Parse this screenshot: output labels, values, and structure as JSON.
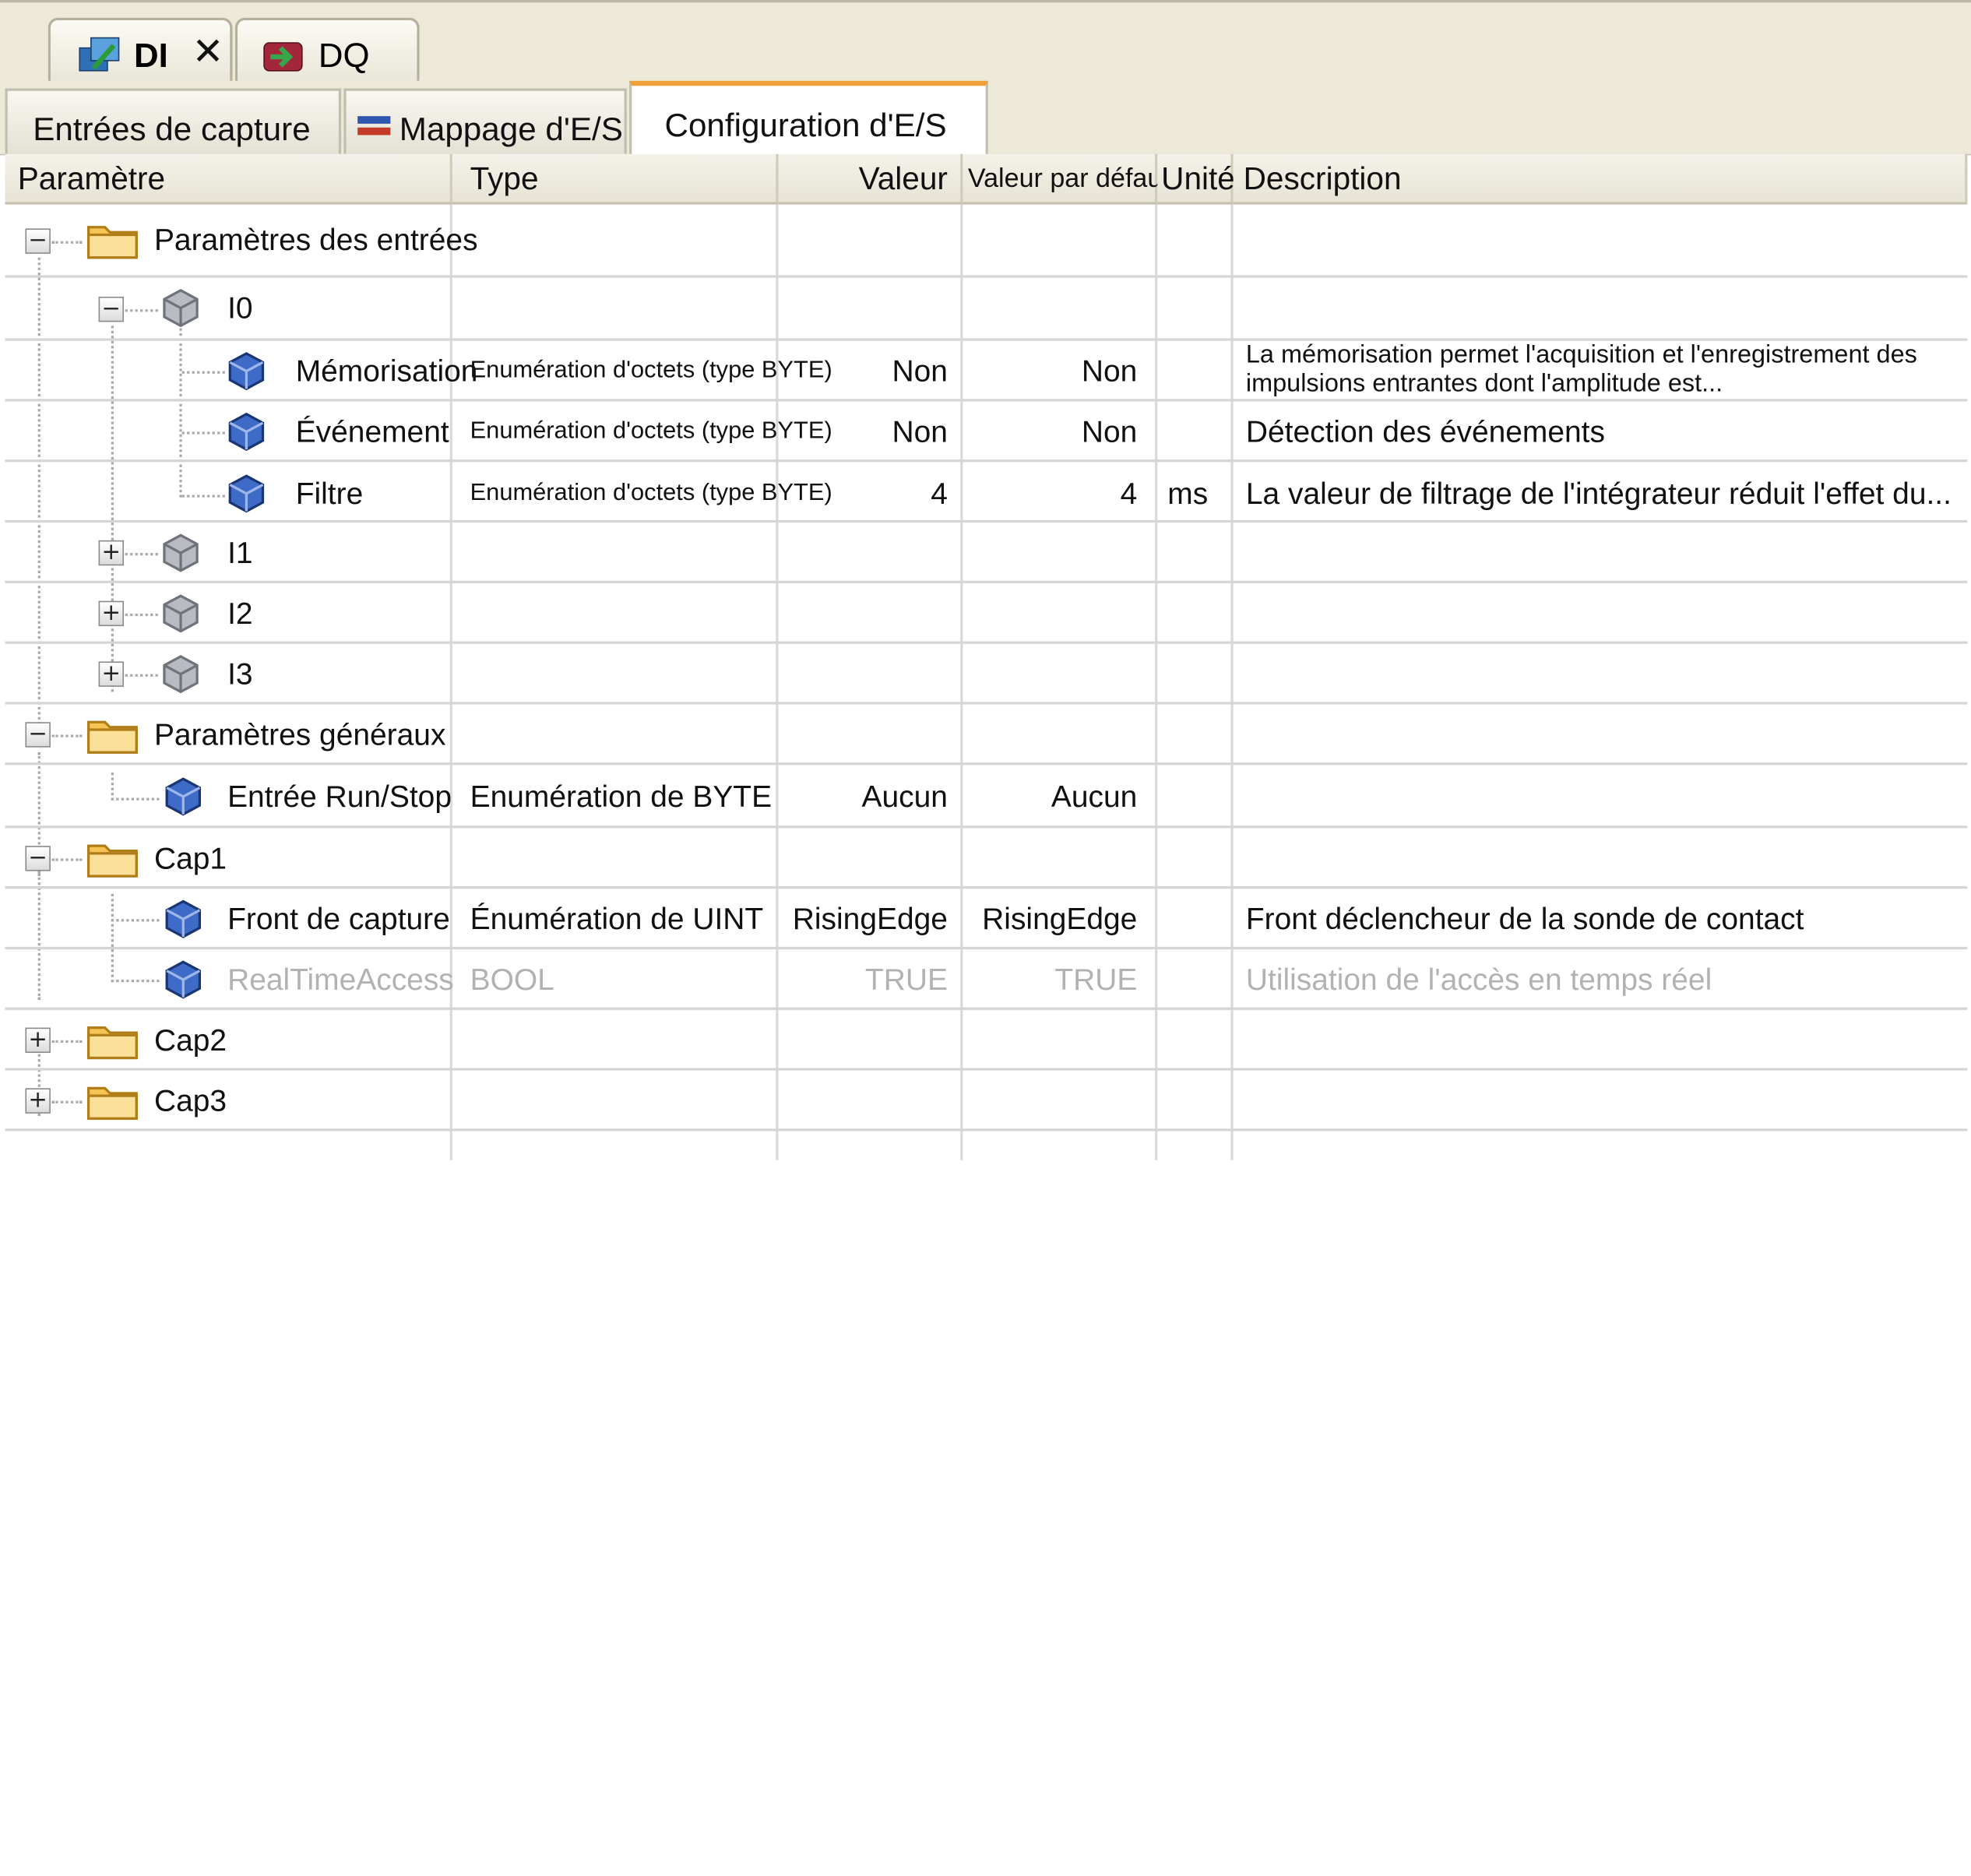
{
  "editor_tabs": [
    {
      "label": "DI",
      "close": "✕"
    },
    {
      "label": "DQ"
    }
  ],
  "config_tabs": [
    {
      "label": "Entrées de capture"
    },
    {
      "label": "Mappage d'E/S"
    },
    {
      "label": "Configuration d'E/S"
    }
  ],
  "columns": {
    "parametre": "Paramètre",
    "type": "Type",
    "valeur": "Valeur",
    "defaut": "Valeur par défaut",
    "unite": "Unité",
    "description": "Description"
  },
  "rows": [
    {
      "name": "Paramètres des entrées",
      "expander": "−"
    },
    {
      "name": "I0",
      "expander": "−"
    },
    {
      "name": "Mémorisation",
      "type": "Enumération d'octets (type BYTE)",
      "value": "Non",
      "default": "Non",
      "unit": "",
      "description_l1": "La mémorisation permet l'acquisition et l'enregistrement des",
      "description_l2": "impulsions entrantes dont l'amplitude est..."
    },
    {
      "name": "Événement",
      "type": "Enumération d'octets (type BYTE)",
      "value": "Non",
      "default": "Non",
      "unit": "",
      "description": "Détection des événements"
    },
    {
      "name": "Filtre",
      "type": "Enumération d'octets (type BYTE)",
      "value": "4",
      "default": "4",
      "unit": "ms",
      "description": "La valeur de filtrage de l'intégrateur réduit l'effet du..."
    },
    {
      "name": "I1",
      "expander": "+"
    },
    {
      "name": "I2",
      "expander": "+"
    },
    {
      "name": "I3",
      "expander": "+"
    },
    {
      "name": "Paramètres généraux",
      "expander": "−"
    },
    {
      "name": "Entrée Run/Stop",
      "type": "Enumération de BYTE",
      "value": "Aucun",
      "default": "Aucun",
      "unit": "",
      "description": ""
    },
    {
      "name": "Cap1",
      "expander": "−"
    },
    {
      "name": "Front de capture",
      "type": "Énumération de UINT",
      "value": "RisingEdge",
      "default": "RisingEdge",
      "unit": "",
      "description": "Front déclencheur de la sonde de contact"
    },
    {
      "name": "RealTimeAccess",
      "type": "BOOL",
      "value": "TRUE",
      "default": "TRUE",
      "unit": "",
      "description": "Utilisation de l'accès en temps réel"
    },
    {
      "name": "Cap2",
      "expander": "+"
    },
    {
      "name": "Cap3",
      "expander": "+"
    }
  ],
  "colors": {
    "active_tab_accent": "#f0a23a",
    "chrome": "#ece9d8",
    "disabled_text": "#b2b2b2"
  }
}
